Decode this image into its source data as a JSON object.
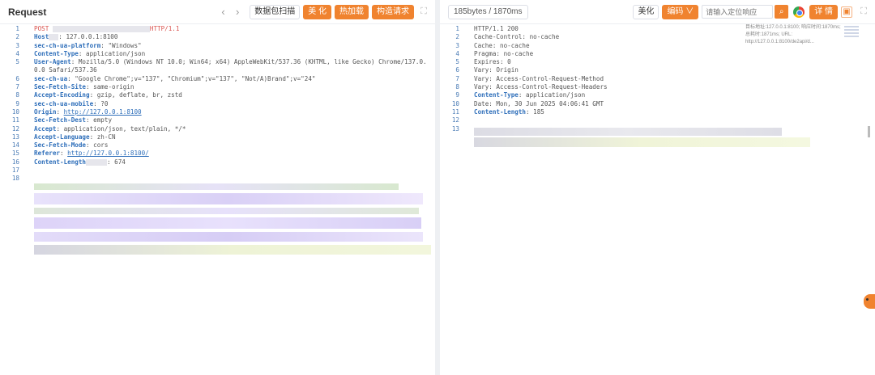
{
  "request": {
    "title": "Request",
    "nav_prev": "‹",
    "nav_next": "›",
    "scan_button": "数据包扫描",
    "beautify_button": "美 化",
    "hotload_button": "热加载",
    "construct_button": "构造请求",
    "expand_icon": "expand-icon",
    "lines": [
      {
        "n": "1",
        "key": "POST",
        "val": "HTTP/1.1",
        "style": "method"
      },
      {
        "n": "2",
        "key": "Host",
        "val": ": 127.0.0.1:8100"
      },
      {
        "n": "3",
        "key": "sec-ch-ua-platform",
        "val": ": \"Windows\""
      },
      {
        "n": "4",
        "key": "Content-Type",
        "val": ": application/json"
      },
      {
        "n": "5",
        "key": "User-Agent",
        "val": ": Mozilla/5.0 (Windows NT 10.0; Win64; x64) AppleWebKit/537.36 (KHTML, like Gecko) Chrome/137.0."
      },
      {
        "n": "",
        "key": "",
        "val": "0.0 Safari/537.36"
      },
      {
        "n": "6",
        "key": "sec-ch-ua",
        "val": ": \"Google Chrome\";v=\"137\", \"Chromium\";v=\"137\", \"Not/A)Brand\";v=\"24\""
      },
      {
        "n": "7",
        "key": "Sec-Fetch-Site",
        "val": ": same-origin"
      },
      {
        "n": "8",
        "key": "Accept-Encoding",
        "val": ": gzip, deflate, br, zstd"
      },
      {
        "n": "9",
        "key": "sec-ch-ua-mobile",
        "val": ": ?0"
      },
      {
        "n": "10",
        "key": "Origin",
        "val": ": ",
        "link": "http://127.0.0.1:8100"
      },
      {
        "n": "11",
        "key": "Sec-Fetch-Dest",
        "val": ": empty"
      },
      {
        "n": "12",
        "key": "Accept",
        "val": ": application/json, text/plain, */*"
      },
      {
        "n": "13",
        "key": "Accept-Language",
        "val": ": zh-CN"
      },
      {
        "n": "14",
        "key": "Sec-Fetch-Mode",
        "val": ": cors"
      },
      {
        "n": "15",
        "key": "Referer",
        "val": ": ",
        "link": "http://127.0.0.1:8100/"
      },
      {
        "n": "16",
        "key": "Content-Length",
        "val": ": 674"
      },
      {
        "n": "17",
        "key": "",
        "val": ""
      },
      {
        "n": "18",
        "key": "",
        "val": ""
      }
    ]
  },
  "response": {
    "meta": "185bytes / 1870ms",
    "beautify_button": "美化",
    "encoding_button": "编码 ∨",
    "search_placeholder": "请输入定位响应",
    "search_icon": "search-icon",
    "chrome_icon": "chrome-icon",
    "detail_button": "详 情",
    "side_info": "目标地址:127.0.0.1:8100; 响应时间:1870ms; 总耗时:1871ms; URL: http://127.0.0.1:8100/de2api/d...",
    "lines": [
      {
        "n": "1",
        "key": "",
        "val": "HTTP/1.1 200"
      },
      {
        "n": "2",
        "key": "",
        "val": "Cache-Control: no-cache"
      },
      {
        "n": "3",
        "key": "",
        "val": "Cache: no-cache"
      },
      {
        "n": "4",
        "key": "",
        "val": "Pragma: no-cache"
      },
      {
        "n": "5",
        "key": "",
        "val": "Expires: 0"
      },
      {
        "n": "6",
        "key": "",
        "val": "Vary: Origin"
      },
      {
        "n": "7",
        "key": "",
        "val": "Vary: Access-Control-Request-Method"
      },
      {
        "n": "8",
        "key": "",
        "val": "Vary: Access-Control-Request-Headers"
      },
      {
        "n": "9",
        "key": "Content-Type",
        "val": ": application/json"
      },
      {
        "n": "10",
        "key": "",
        "val": "Date: Mon, 30 Jun 2025 04:06:41 GMT"
      },
      {
        "n": "11",
        "key": "Content-Length",
        "val": ": 185"
      },
      {
        "n": "12",
        "key": "",
        "val": ""
      },
      {
        "n": "13",
        "key": "",
        "val": ""
      }
    ]
  }
}
